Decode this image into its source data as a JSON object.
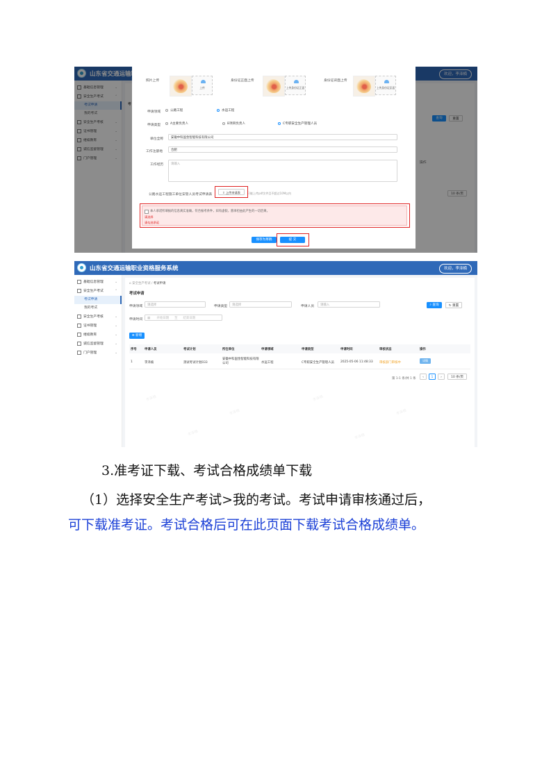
{
  "system_name": "山东省交通运输职业资格服务系统",
  "system_name_truncated": "山东省交通运输职",
  "user_label": "欢迎，李泽楠",
  "sidebar": {
    "items": [
      {
        "label": "基础信息管理"
      },
      {
        "label": "安全生产考试"
      },
      {
        "label": "安全生产考核"
      },
      {
        "label": "证书管理"
      },
      {
        "label": "继续教育"
      },
      {
        "label": "诚信监督管理"
      },
      {
        "label": "门户管理"
      }
    ],
    "sub_items": [
      "考试申请",
      "我的考试"
    ]
  },
  "modal": {
    "photo_label": "照片上传",
    "idfront_label": "身份证正面上传",
    "idback_label": "身份证背面上传",
    "upload_caption": "上传",
    "upload_front_caption": "上传身份证正面",
    "upload_back_caption": "上传身份证反面",
    "field_label": "申请领域",
    "field_options": [
      "公路工程",
      "水运工程"
    ],
    "type_label": "申请类型",
    "type_options": [
      "A主要负责人",
      "B项目负责人",
      "C专职安全生产管理人员"
    ],
    "company_label": "单位全称",
    "company_value": "安徽中科国金智能科技有限公司",
    "location_label": "工作注册地",
    "location_value": "合肥",
    "experience_label": "工作经历",
    "experience_placeholder": "请输入",
    "form_label": "公路水运工程施工单位安管人员考试申请表",
    "upload_file_button": "上传申请表",
    "upload_hint": "只能上传pdf文件且不超过10M以内",
    "pledge_text": "本人承诺所填报的信息真实准确，符合报考条件，如有虚假，愿承担由此产生的一切后果。",
    "pledge_error_1": "请选择",
    "pledge_error_2": "请勾选承诺",
    "save_draft_button": "保存为草稿",
    "submit_button": "提 交"
  },
  "bg_panel": {
    "page_title": "考",
    "query_button": "查询",
    "reset_button": "重置",
    "page_size": "10 条/页",
    "action_header": "操作"
  },
  "page": {
    "breadcrumb_home": "安全生产考试",
    "breadcrumb_current": "考试申请",
    "title": "考试申请",
    "filters": {
      "field_label": "申请领域",
      "field_placeholder": "请选择",
      "type_label": "申请类型",
      "type_placeholder": "请选择",
      "applicant_label": "申请人员",
      "applicant_placeholder": "请输入",
      "time_label": "申请时间",
      "start_placeholder": "开始日期",
      "date_sep": "至",
      "end_placeholder": "结束日期"
    },
    "query_button": "查询",
    "reset_button": "重置",
    "add_button": "新增",
    "table": {
      "headers": [
        "序号",
        "申请人员",
        "考试计划",
        "所在单位",
        "申请领域",
        "申请类型",
        "申请时间",
        "审核状态",
        "操作"
      ],
      "rows": [
        [
          "1",
          "李泽楠",
          "测试考试计划033",
          "安徽中科国金智能科技有限公司",
          "水运工程",
          "C专职安全生产管理人员",
          "2025-05-06 11:48:33",
          "审核部门审核中",
          "详情"
        ]
      ]
    },
    "pagination": {
      "summary": "第 1-1 条/共 1 条",
      "current_page": "1",
      "page_size": "10 条/页"
    }
  },
  "watermark_text": "李泽楠",
  "doc": {
    "heading": "3.准考证下载、考试合格成绩单下载",
    "para_line1": "（1）选择安全生产考试>我的考试。考试申请审核通过后，",
    "para_line2": "可下载准考证。考试合格后可在此页面下载考试合格成绩单。"
  },
  "colors": {
    "header_blue": "#2f69b8",
    "primary": "#1890ff",
    "highlight_red": "#e02020",
    "doc_blue": "#1a3fd6"
  }
}
